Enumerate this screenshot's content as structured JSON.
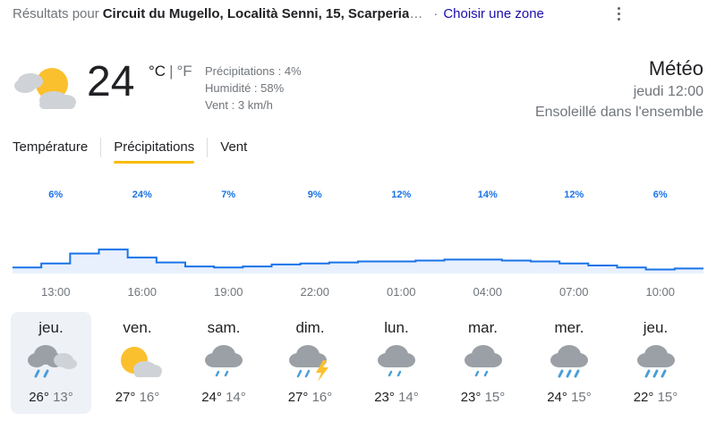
{
  "location_bar": {
    "prefix": "Résultats pour",
    "location": "Circuit du Mugello, Località Senni, 15, Scarperia",
    "separator": "·",
    "choose_zone": "Choisir une zone"
  },
  "current": {
    "icon": "partly-cloudy-icon",
    "temperature": "24",
    "unit_c": "°C",
    "unit_sep": "|",
    "unit_f": "°F",
    "precipitation": "Précipitations : 4%",
    "humidity": "Humidité : 58%",
    "wind": "Vent : 3 km/h"
  },
  "summary": {
    "title": "Météo",
    "time": "jeudi 12:00",
    "description": "Ensoleillé dans l'ensemble"
  },
  "tabs": [
    {
      "label": "Température",
      "selected": false
    },
    {
      "label": "Précipitations",
      "selected": true
    },
    {
      "label": "Vent",
      "selected": false
    }
  ],
  "chart_data": {
    "type": "area",
    "x": [
      "13:00",
      "14:00",
      "15:00",
      "16:00",
      "17:00",
      "18:00",
      "19:00",
      "20:00",
      "21:00",
      "22:00",
      "23:00",
      "00:00",
      "01:00",
      "02:00",
      "03:00",
      "04:00",
      "05:00",
      "06:00",
      "07:00",
      "08:00",
      "09:00",
      "10:00",
      "11:00",
      "12:00"
    ],
    "values": [
      6,
      10,
      20,
      24,
      16,
      11,
      7,
      6,
      7,
      9,
      10,
      11,
      12,
      12,
      13,
      14,
      14,
      13,
      12,
      10,
      8,
      6,
      4,
      5
    ],
    "ylim": [
      0,
      100
    ],
    "label_every": 3,
    "color": "#1a73e8"
  },
  "days": [
    {
      "name": "jeu.",
      "icon": "rain-cloud-icon",
      "high": "26",
      "low": "13",
      "selected": true
    },
    {
      "name": "ven.",
      "icon": "partly-sunny-icon",
      "high": "27",
      "low": "16",
      "selected": false
    },
    {
      "name": "sam.",
      "icon": "showers-icon",
      "high": "24",
      "low": "14",
      "selected": false
    },
    {
      "name": "dim.",
      "icon": "thunderstorm-icon",
      "high": "27",
      "low": "16",
      "selected": false
    },
    {
      "name": "lun.",
      "icon": "showers-icon",
      "high": "23",
      "low": "14",
      "selected": false
    },
    {
      "name": "mar.",
      "icon": "showers-icon",
      "high": "23",
      "low": "15",
      "selected": false
    },
    {
      "name": "mer.",
      "icon": "rain-icon",
      "high": "24",
      "low": "15",
      "selected": false
    },
    {
      "name": "jeu.",
      "icon": "rain-icon",
      "high": "22",
      "low": "15",
      "selected": false
    }
  ],
  "degree": "°"
}
